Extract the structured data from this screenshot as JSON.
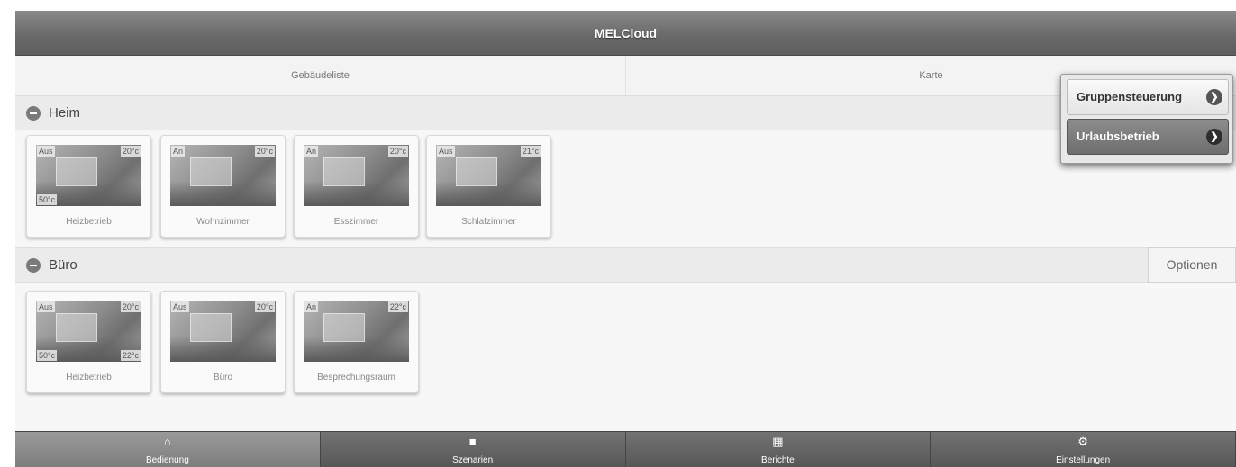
{
  "app": {
    "title": "MELCloud"
  },
  "nav_tabs": [
    {
      "label": "Gebäudeliste"
    },
    {
      "label": "Karte"
    }
  ],
  "popup": {
    "items": [
      {
        "label": "Gruppensteuerung"
      },
      {
        "label": "Urlaubsbetrieb"
      }
    ]
  },
  "groups": [
    {
      "name": "Heim",
      "cards": [
        {
          "name": "Heizbetrieb",
          "status": "Aus",
          "temp": "20°c",
          "extra_left": "50°c",
          "extra_right": ""
        },
        {
          "name": "Wohnzimmer",
          "status": "An",
          "temp": "20°c",
          "extra_left": "",
          "extra_right": ""
        },
        {
          "name": "Esszimmer",
          "status": "An",
          "temp": "20°c",
          "extra_left": "",
          "extra_right": ""
        },
        {
          "name": "Schlafzimmer",
          "status": "Aus",
          "temp": "21°c",
          "extra_left": "",
          "extra_right": ""
        }
      ]
    },
    {
      "name": "Büro",
      "options_label": "Optionen",
      "cards": [
        {
          "name": "Heizbetrieb",
          "status": "Aus",
          "temp": "20°c",
          "extra_left": "50°c",
          "extra_right": "22°c"
        },
        {
          "name": "Büro",
          "status": "Aus",
          "temp": "20°c",
          "extra_left": "",
          "extra_right": ""
        },
        {
          "name": "Besprechungsraum",
          "status": "An",
          "temp": "22°c",
          "extra_left": "",
          "extra_right": ""
        }
      ]
    }
  ],
  "bottom_tabs": [
    {
      "label": "Bedienung",
      "icon": "home-icon"
    },
    {
      "label": "Szenarien",
      "icon": "camera-icon"
    },
    {
      "label": "Berichte",
      "icon": "grid-icon"
    },
    {
      "label": "Einstellungen",
      "icon": "gear-icon"
    }
  ]
}
